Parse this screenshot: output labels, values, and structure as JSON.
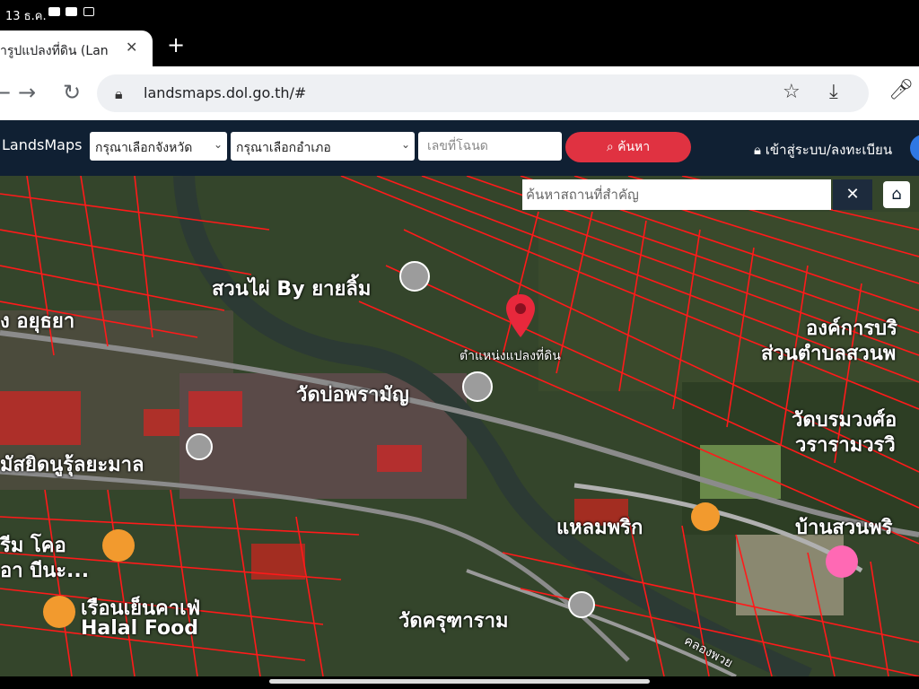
{
  "status_bar": {
    "time": "13 ธ.ค."
  },
  "tab": {
    "title": "ารูปแปลงที่ดิน (Lan",
    "close": "✕",
    "new_tab": "+"
  },
  "toolbar": {
    "url": "landsmaps.dol.go.th/#"
  },
  "site": {
    "logo": "LandsMaps",
    "province_placeholder": "กรุณาเลือกจังหวัด",
    "district_placeholder": "กรุณาเลือกอำเภอ",
    "deed_placeholder": "เลขที่โฉนด",
    "search_label": "ค้นหา",
    "login_label": "เข้าสู่ระบบ/ลงทะเบียน"
  },
  "map": {
    "place_search_placeholder": "ค้นหาสถานที่สำคัญ",
    "clear_label": "✕",
    "labels": [
      "สวนไผ่ By ยายลิ้ม",
      "ง อยุธยา",
      "ตำแหน่งแปลงที่ดิน",
      "วัดบ่อพรามัญ",
      "องค์การบริ",
      "ส่วนตำบลสวนพ",
      "วัดบรมวงศ์อ",
      "วรารามวรวิ",
      "มัสยิดนูรุ้ลยะมาล",
      "แหลมพริก",
      "บ้านสวนพริ",
      "รีม โคอ",
      "อา บีนะ...",
      "เรือนเย็นคาเฟ่",
      "Halal Food",
      "วัดครุฑาราม",
      "คลองพวย"
    ]
  },
  "icons": [
    "back-arrow-icon",
    "forward-arrow-icon",
    "reload-icon",
    "lock-icon",
    "star-icon",
    "download-icon",
    "mic-icon",
    "search-icon",
    "home-icon",
    "location-pin-icon"
  ],
  "colors": {
    "header_bg": "#102033",
    "search_button": "#e03241",
    "parcel_lines": "#ff1a1a",
    "pin": "#e8283c"
  }
}
